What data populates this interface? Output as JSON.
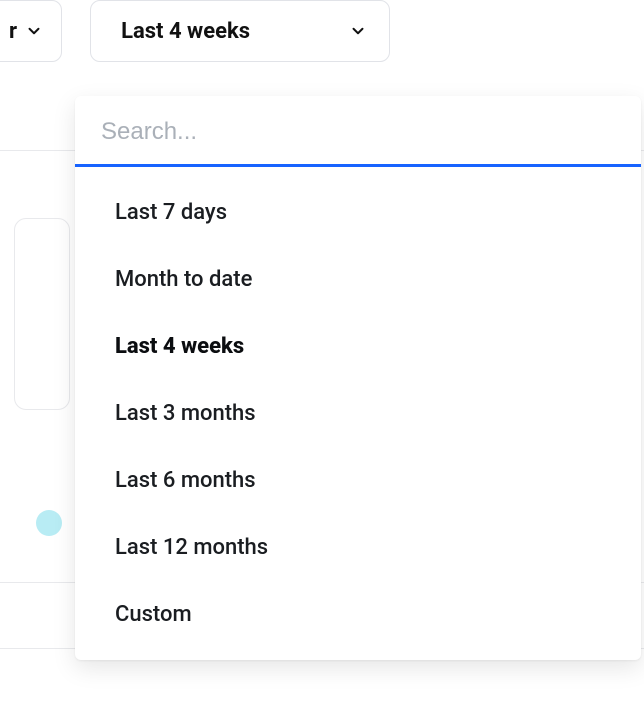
{
  "top": {
    "partial_select_fragment": "r",
    "date_select_label": "Last 4 weeks"
  },
  "dropdown": {
    "search_placeholder": "Search...",
    "options": [
      {
        "label": "Last 7 days",
        "selected": false
      },
      {
        "label": "Month to date",
        "selected": false
      },
      {
        "label": "Last 4 weeks",
        "selected": true
      },
      {
        "label": "Last 3 months",
        "selected": false
      },
      {
        "label": "Last 6 months",
        "selected": false
      },
      {
        "label": "Last 12 months",
        "selected": false
      },
      {
        "label": "Custom",
        "selected": false
      }
    ]
  }
}
